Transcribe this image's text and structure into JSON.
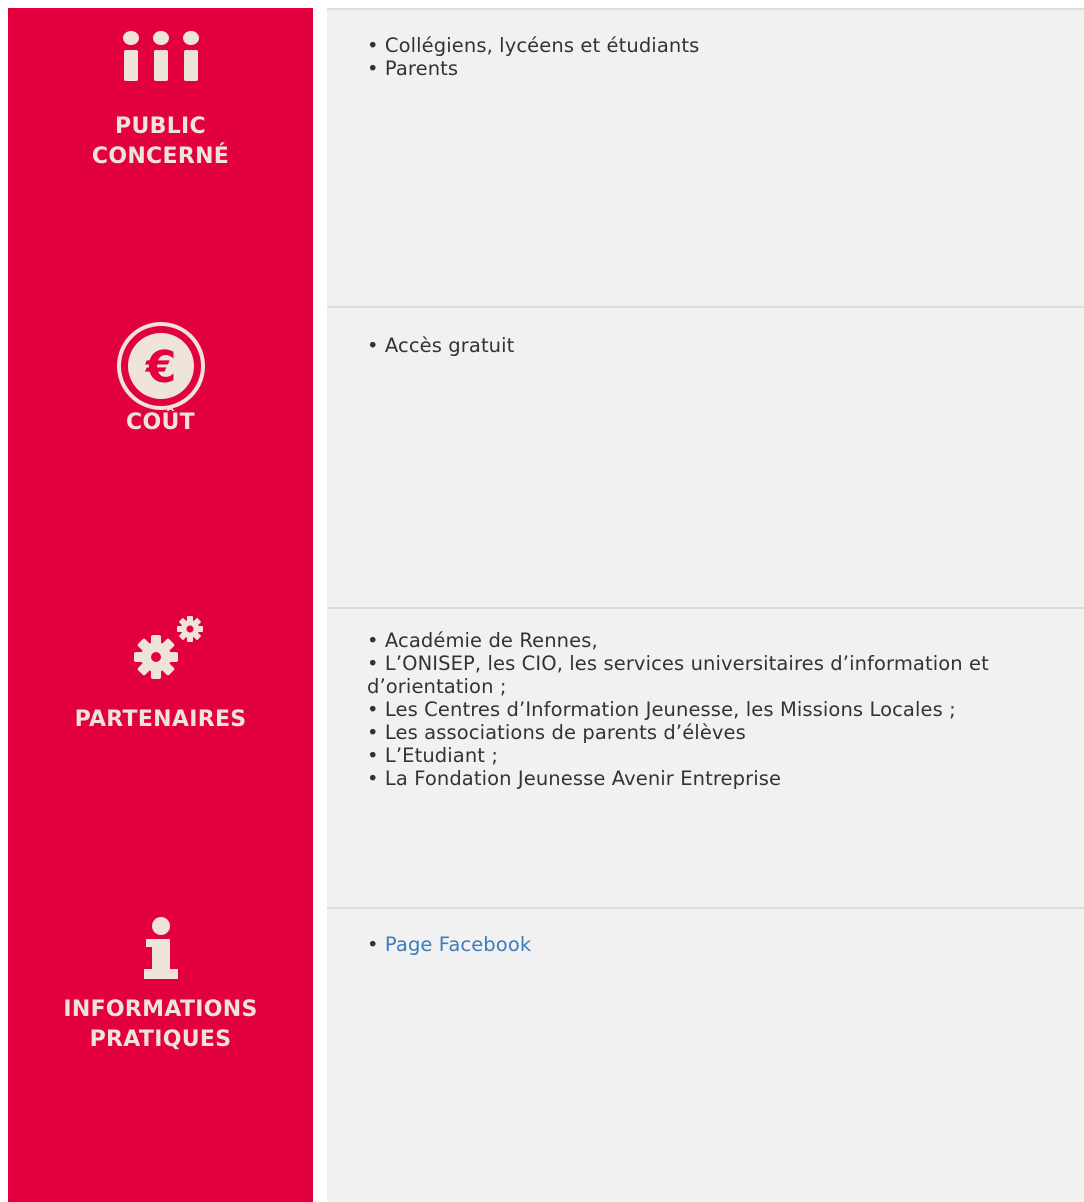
{
  "colors": {
    "label_background": "#e2003e",
    "label_text": "#eee4d7",
    "content_background": "#f1f1f1",
    "content_text": "#333333",
    "link": "#3a7dc0"
  },
  "rows": [
    {
      "icon": "people-icon",
      "label": "PUBLIC\nCONCERNÉ",
      "items": [
        "• Collégiens, lycéens et étudiants",
        "• Parents"
      ]
    },
    {
      "icon": "euro-coin-icon",
      "label": "COÛT",
      "items": [
        "• Accès gratuit"
      ]
    },
    {
      "icon": "gears-icon",
      "label": "PARTENAIRES",
      "items": [
        "• Académie de Rennes,",
        "• L’ONISEP, les CIO, les services universitaires d’information et d’orientation ;",
        "• Les Centres d’Information Jeunesse, les Missions Locales ;",
        "• Les associations de parents d’élèves",
        "• L’Etudiant ;",
        "• La Fondation Jeunesse Avenir Entreprise"
      ]
    },
    {
      "icon": "info-icon",
      "label": "INFORMATIONS\nPRATIQUES",
      "bullet": "• ",
      "link_text": "Page Facebook"
    }
  ]
}
